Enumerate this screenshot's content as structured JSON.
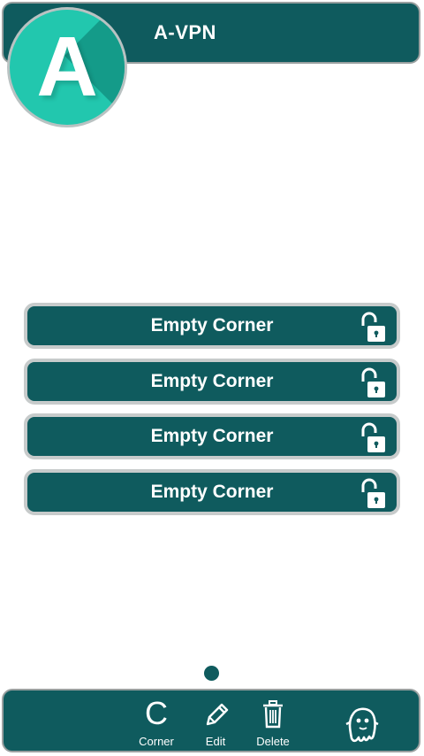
{
  "header": {
    "title": "A-VPN",
    "logo_letter": "A"
  },
  "corners": [
    {
      "label": "Empty Corner",
      "icon": "unlock-icon"
    },
    {
      "label": "Empty Corner",
      "icon": "unlock-icon"
    },
    {
      "label": "Empty Corner",
      "icon": "unlock-icon"
    },
    {
      "label": "Empty Corner",
      "icon": "unlock-icon"
    }
  ],
  "toolbar": {
    "corner_glyph": "C",
    "corner_label": "Corner",
    "edit_label": "Edit",
    "delete_label": "Delete",
    "ghost_icon": "ghost-icon"
  },
  "colors": {
    "primary": "#0f5b5e",
    "logo": "#22c7ae",
    "border": "#c7cbcb"
  }
}
